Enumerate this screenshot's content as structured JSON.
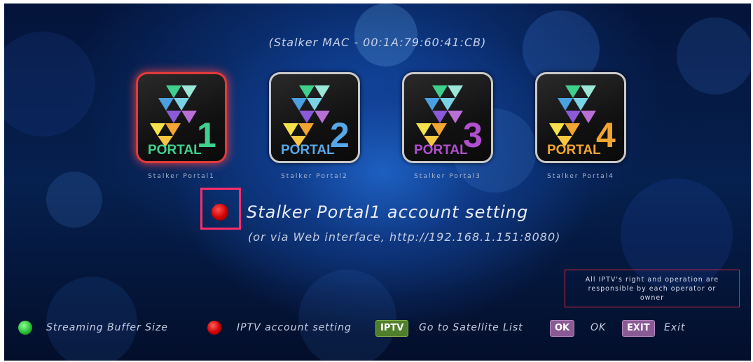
{
  "header": {
    "mac_text": "(Stalker MAC - 00:1A:79:60:41:CB)"
  },
  "portals": [
    {
      "digit": "1",
      "label": "Stalker Portal1",
      "word": "PORTAL",
      "color": "#3fd08e",
      "selected": true
    },
    {
      "digit": "2",
      "label": "Stalker Portal2",
      "word": "PORTAL",
      "color": "#56a8e8",
      "selected": false
    },
    {
      "digit": "3",
      "label": "Stalker Portal3",
      "word": "PORTAL",
      "color": "#b04fcf",
      "selected": false
    },
    {
      "digit": "4",
      "label": "Stalker Portal4",
      "word": "PORTAL",
      "color": "#f2a531",
      "selected": false
    }
  ],
  "setting": {
    "title": "Stalker Portal1 account setting",
    "subtitle": "(or via Web interface, http://192.168.1.151:8080)"
  },
  "notice": {
    "line1": "All IPTV's right and operation are",
    "line2": "responsible by each operator or",
    "line3": "owner"
  },
  "legend": {
    "green_text": "Streaming Buffer Size",
    "red_text": "IPTV account setting",
    "iptv_key": "IPTV",
    "iptv_text": "Go to Satellite List",
    "ok_key": "OK",
    "ok_text": "OK",
    "exit_key": "EXIT",
    "exit_text": "Exit"
  },
  "colors": {
    "selected_border": "#e23a3a",
    "focus_box": "#ff2d6c",
    "notice_border": "#d8263a"
  }
}
